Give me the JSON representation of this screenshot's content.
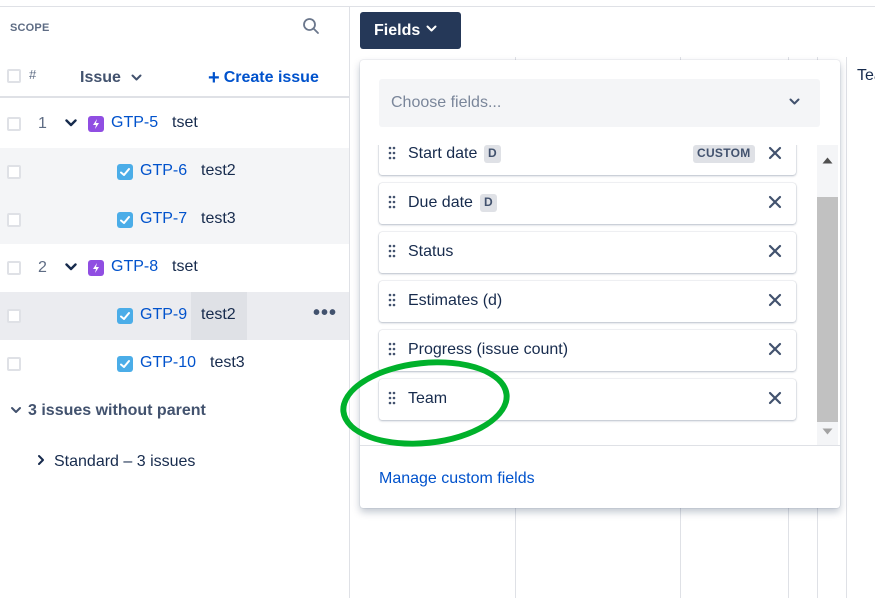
{
  "scope": {
    "label": "SCOPE",
    "columns": {
      "hash": "#",
      "issue": "Issue",
      "create": "Create issue"
    },
    "rows": [
      {
        "num": "1",
        "key": "GTP-5",
        "summary": "tset",
        "type": "epic",
        "expanded": true
      },
      {
        "num": "",
        "key": "GTP-6",
        "summary": "test2",
        "type": "task"
      },
      {
        "num": "",
        "key": "GTP-7",
        "summary": "test3",
        "type": "task"
      },
      {
        "num": "2",
        "key": "GTP-8",
        "summary": "tset",
        "type": "epic",
        "expanded": true
      },
      {
        "num": "",
        "key": "GTP-9",
        "summary": "test2",
        "type": "task",
        "more": "•••"
      },
      {
        "num": "",
        "key": "GTP-10",
        "summary": "test3",
        "type": "task"
      }
    ],
    "group": "3 issues without parent",
    "subgroup": "Standard – 3 issues"
  },
  "timeline": {
    "fields_button": "Fields",
    "column_partial": "Tea"
  },
  "fields_dropdown": {
    "placeholder": "Choose fields...",
    "items": [
      {
        "label": "Start date",
        "tag": "D",
        "custom": "CUSTOM"
      },
      {
        "label": "Due date",
        "tag": "D"
      },
      {
        "label": "Status"
      },
      {
        "label": "Estimates (d)"
      },
      {
        "label": "Progress (issue count)"
      },
      {
        "label": "Team"
      }
    ],
    "manage_link": "Manage custom fields"
  },
  "colors": {
    "link": "#0052cc",
    "button_bg": "#253858",
    "epic": "#904ee2",
    "task": "#4bade8",
    "annotation": "#00b12b"
  }
}
